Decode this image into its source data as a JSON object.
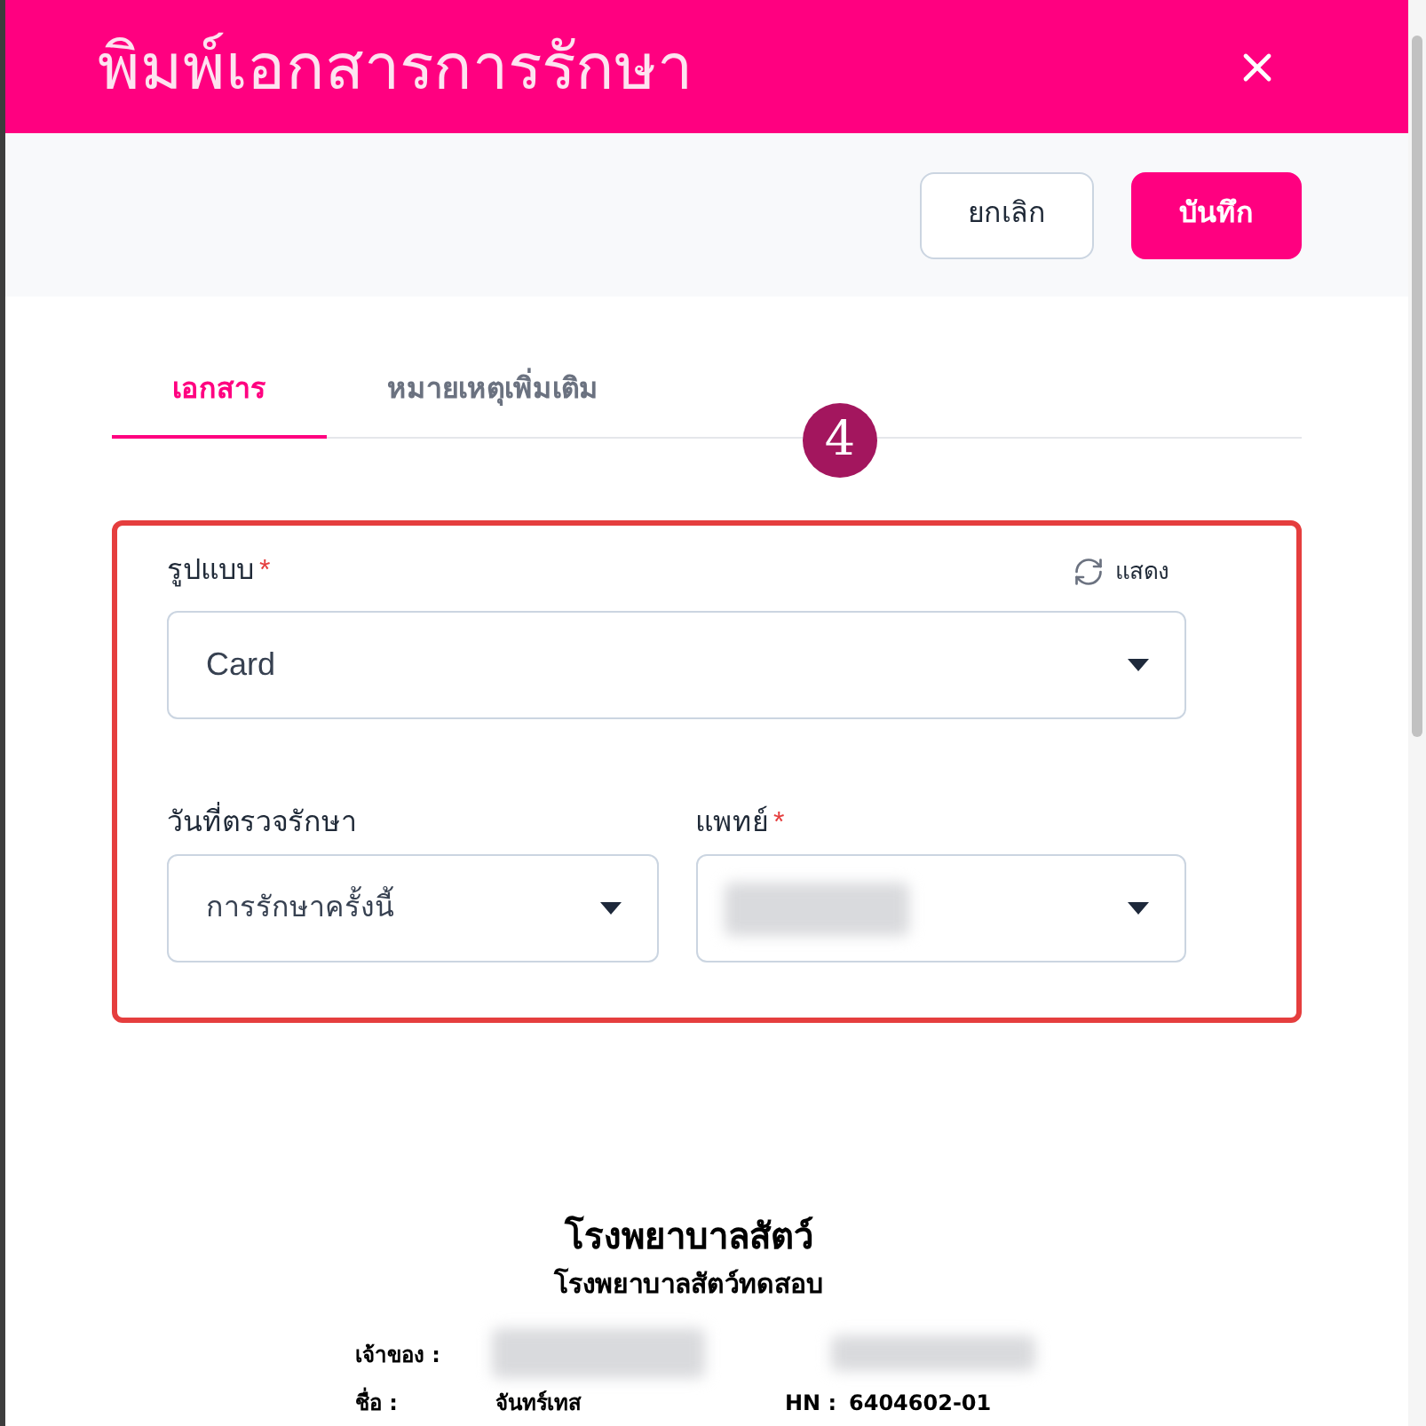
{
  "dialog": {
    "title": "พิมพ์เอกสารการรักษา"
  },
  "actions": [
    {
      "label": "ยกเลิก",
      "kind": "secondary"
    },
    {
      "label": "บันทึก",
      "kind": "primary"
    }
  ],
  "tabs": [
    {
      "label": "เอกสาร",
      "selected": true
    },
    {
      "label": "หมายเหตุเพิ่มเติม",
      "selected": false
    }
  ],
  "step_badge": "4",
  "form": {
    "format": {
      "label": "รูปแบบ",
      "required_mark": "*",
      "value": "Card",
      "refresh": "แสดง"
    },
    "fields": [
      {
        "label": "วันที่ตรวจรักษา",
        "value": "การรักษาครั้งนี้",
        "redacted": false
      },
      {
        "label": "แพทย์",
        "required_mark": "*",
        "redacted": true
      }
    ]
  },
  "preview": {
    "title": "โรงพยาบาลสัตว์",
    "subtitle": "โรงพยาบาลสัตว์ทดสอบ",
    "rows": [
      {
        "cells": [
          {
            "kind": "label",
            "text": "เจ้าของ :"
          },
          {
            "kind": "redacted"
          },
          {
            "kind": "redacted"
          }
        ]
      },
      {
        "cells": [
          {
            "kind": "label",
            "text": "ชื่อ :"
          },
          {
            "kind": "value",
            "text": "จันทร์เทส"
          },
          {
            "kind": "label",
            "text": "HN :"
          },
          {
            "kind": "value",
            "text": "6404602-01"
          }
        ]
      }
    ]
  }
}
